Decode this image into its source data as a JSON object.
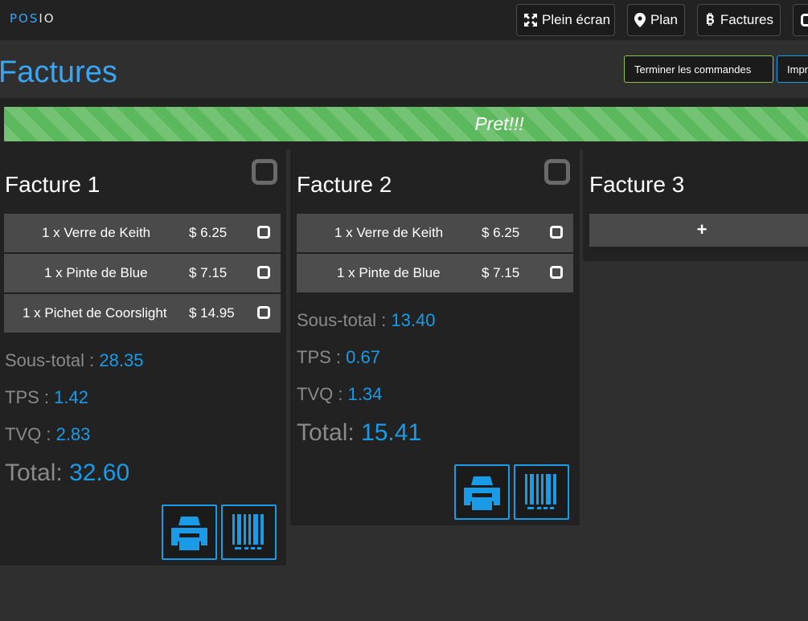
{
  "app": {
    "brand_part1": "POS",
    "brand_part2": "IO"
  },
  "nav": {
    "fullscreen": "Plein écran",
    "plan": "Plan",
    "factures": "Factures"
  },
  "page": {
    "title": "Factures",
    "finish_orders": "Terminer les commandes",
    "print_partial": "Impr"
  },
  "status": {
    "label": "Pret!!!",
    "progress_percent": 100
  },
  "invoices": [
    {
      "title": "Facture 1",
      "items": [
        {
          "qty_name": "1 x Verre de Keith",
          "price": "$ 6.25"
        },
        {
          "qty_name": "1 x Pinte de Blue",
          "price": "$ 7.15"
        },
        {
          "qty_name": "1 x Pichet de Coorslight",
          "price": "$ 14.95"
        }
      ],
      "subtotal_label": "Sous-total :",
      "subtotal": "28.35",
      "tps_label": "TPS :",
      "tps": "1.42",
      "tvq_label": "TVQ :",
      "tvq": "2.83",
      "total_label": "Total:",
      "total": "32.60"
    },
    {
      "title": "Facture 2",
      "items": [
        {
          "qty_name": "1 x Verre de Keith",
          "price": "$ 6.25"
        },
        {
          "qty_name": "1 x Pinte de Blue",
          "price": "$ 7.15"
        }
      ],
      "subtotal_label": "Sous-total :",
      "subtotal": "13.40",
      "tps_label": "TPS :",
      "tps": "0.67",
      "tvq_label": "TVQ :",
      "tvq": "1.34",
      "total_label": "Total:",
      "total": "15.41"
    },
    {
      "title": "Facture 3",
      "add_label": "+"
    }
  ],
  "icons": {
    "fullscreen": "expand-icon",
    "plan": "map-marker-icon",
    "factures": "bitcoin-icon",
    "print": "print-icon",
    "barcode": "barcode-icon",
    "checkbox": "square-icon"
  },
  "colors": {
    "accent": "#3aa5f0",
    "value": "#1a9be8",
    "success": "#5cb85c",
    "panel": "#222222",
    "item": "#4a4a4a"
  }
}
